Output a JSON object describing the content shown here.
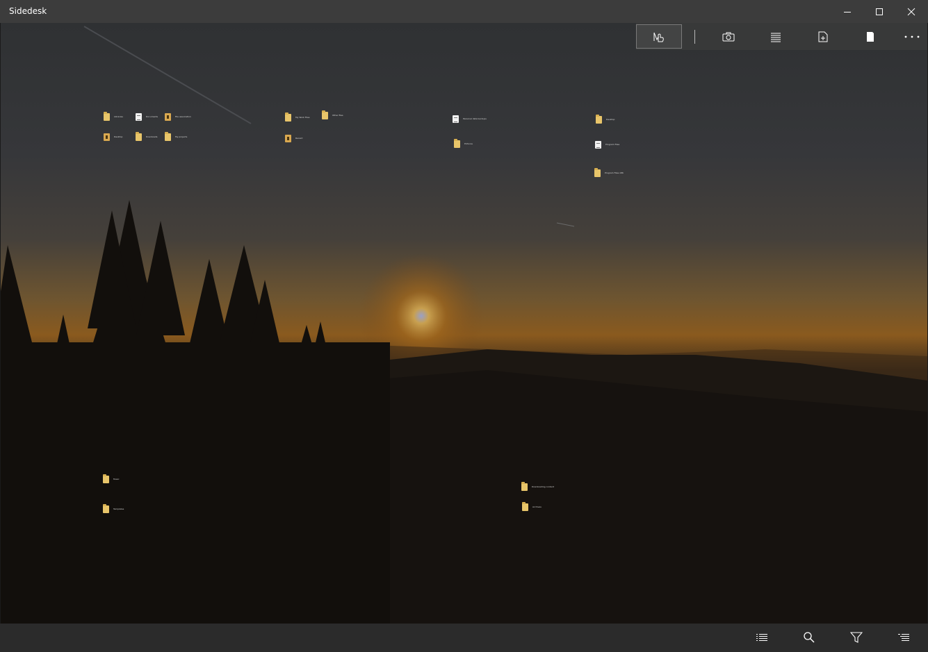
{
  "window": {
    "title": "Sidedesk",
    "controls": [
      "minimize-icon",
      "maximize-icon",
      "close-icon"
    ]
  },
  "toolbar": {
    "buttons": [
      {
        "name": "select-pointer-icon",
        "active": true
      },
      {
        "name": "camera-icon"
      },
      {
        "name": "align-lines-icon"
      },
      {
        "name": "new-file-icon"
      },
      {
        "name": "page-icon"
      },
      {
        "name": "more-icon"
      }
    ]
  },
  "desktop": {
    "icons": [
      {
        "label": "Libraries",
        "kind": "folder"
      },
      {
        "label": "Documents",
        "kind": "doc"
      },
      {
        "label": "File association",
        "kind": "shortcut"
      },
      {
        "label": "Desktop",
        "kind": "shortcut"
      },
      {
        "label": "Downloads",
        "kind": "folder"
      },
      {
        "label": "My projects",
        "kind": "folder"
      },
      {
        "label": "My Work Files",
        "kind": "folder"
      },
      {
        "label": "Other files",
        "kind": "folder"
      },
      {
        "label": "Recent",
        "kind": "shortcut"
      },
      {
        "label": "Personal data backups",
        "kind": "folder"
      },
      {
        "label": "Pictures",
        "kind": "folder"
      },
      {
        "label": "Desktop",
        "kind": "folder"
      },
      {
        "label": "Program Files",
        "kind": "shortcut"
      },
      {
        "label": "Program Files x86",
        "kind": "folder"
      },
      {
        "label": "Music",
        "kind": "folder"
      },
      {
        "label": "Templates",
        "kind": "folder"
      },
      {
        "label": "Downloading content",
        "kind": "folder"
      },
      {
        "label": "Archives",
        "kind": "folder"
      }
    ]
  },
  "bottombar": {
    "buttons": [
      "list-view-icon",
      "search-icon",
      "filter-icon",
      "sort-icon"
    ]
  }
}
